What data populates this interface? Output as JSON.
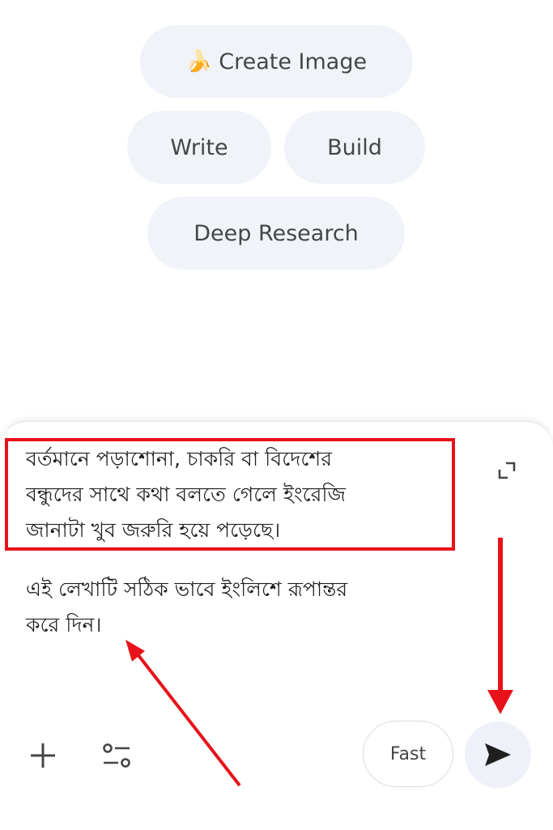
{
  "suggestions": {
    "create_image": {
      "emoji": "🍌",
      "label": "Create Image"
    },
    "write": {
      "label": "Write"
    },
    "build": {
      "label": "Build"
    },
    "deep_research": {
      "label": "Deep Research"
    }
  },
  "composer": {
    "highlighted_text": "বর্তমানে পড়াশোনা, চাকরি বা বিদেশের\nবন্ধুদের সাথে কথা বলতে গেলে ইংরেজি\nজানাটা খুব জরুরি হয়ে পড়েছে।",
    "instruction_text": "এই লেখাটি সঠিক ভাবে ইংলিশে রূপান্তর\nকরে দিন।",
    "mode_label": "Fast"
  },
  "icons": {
    "expand": "expand-icon",
    "add": "plus-icon",
    "tools": "tools-sliders-icon",
    "send": "send-icon"
  },
  "colors": {
    "chip_bg": "#f0f3f8",
    "chip_text": "#444746",
    "annotation_red": "#e8121a",
    "send_bg": "#eef1f7"
  }
}
